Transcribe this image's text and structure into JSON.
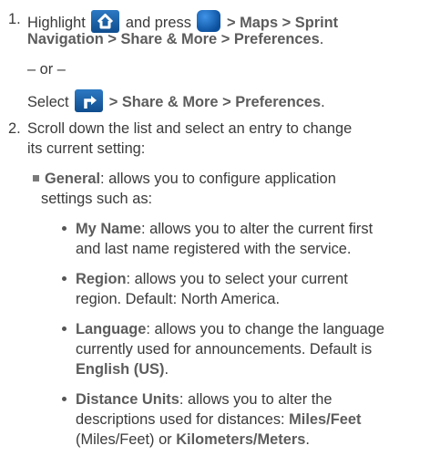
{
  "steps": {
    "s1": {
      "num": "1.",
      "l1_a": "Highlight",
      "l1_b": "and press",
      "l1_c": ">",
      "l1_d": "Maps",
      "l1_e": ">",
      "l1_f": "Sprint",
      "l2_a": "Navigation",
      "l2_b": ">",
      "l2_c": "Share & More",
      "l2_d": ">",
      "l2_e": "Preferences",
      "l2_f": ".",
      "or": "– or –",
      "l3_a": "Select",
      "l3_b": ">",
      "l3_c": "Share & More",
      "l3_d": ">",
      "l3_e": "Preferences",
      "l3_f": "."
    },
    "s2": {
      "num": "2.",
      "l1": "Scroll down the list and select an entry to change",
      "l2": "its current setting:"
    }
  },
  "general": {
    "term": "General",
    "l1": ": allows you to configure application",
    "l2": "settings such as:"
  },
  "items": {
    "myname": {
      "term": "My Name",
      "l1": ": allows you to alter the current first",
      "l2": "and last name registered with the service."
    },
    "region": {
      "term": "Region",
      "l1": ": allows you to select your current",
      "l2": "region. Default: North America."
    },
    "language": {
      "term": "Language",
      "l1": ": allows you to change the language",
      "l2": "currently used for announcements. Default is",
      "l3_b": "English (US)",
      "l3_e": "."
    },
    "units": {
      "term": "Distance Units",
      "l1": ": allows you to alter the",
      "l2_a": "descriptions used for distances:",
      "l2_b": "Miles/Feet",
      "l3_a": "(Miles/Feet) or",
      "l3_b": "Kilometers/Meters",
      "l3_c": "."
    }
  },
  "icons": {
    "home": "home-icon",
    "menu": "menu-key-icon",
    "nav": "turn-arrow-icon"
  },
  "colors": {
    "icon_blue": "#1a5fa8",
    "bold_text": "#5c5c5c"
  }
}
